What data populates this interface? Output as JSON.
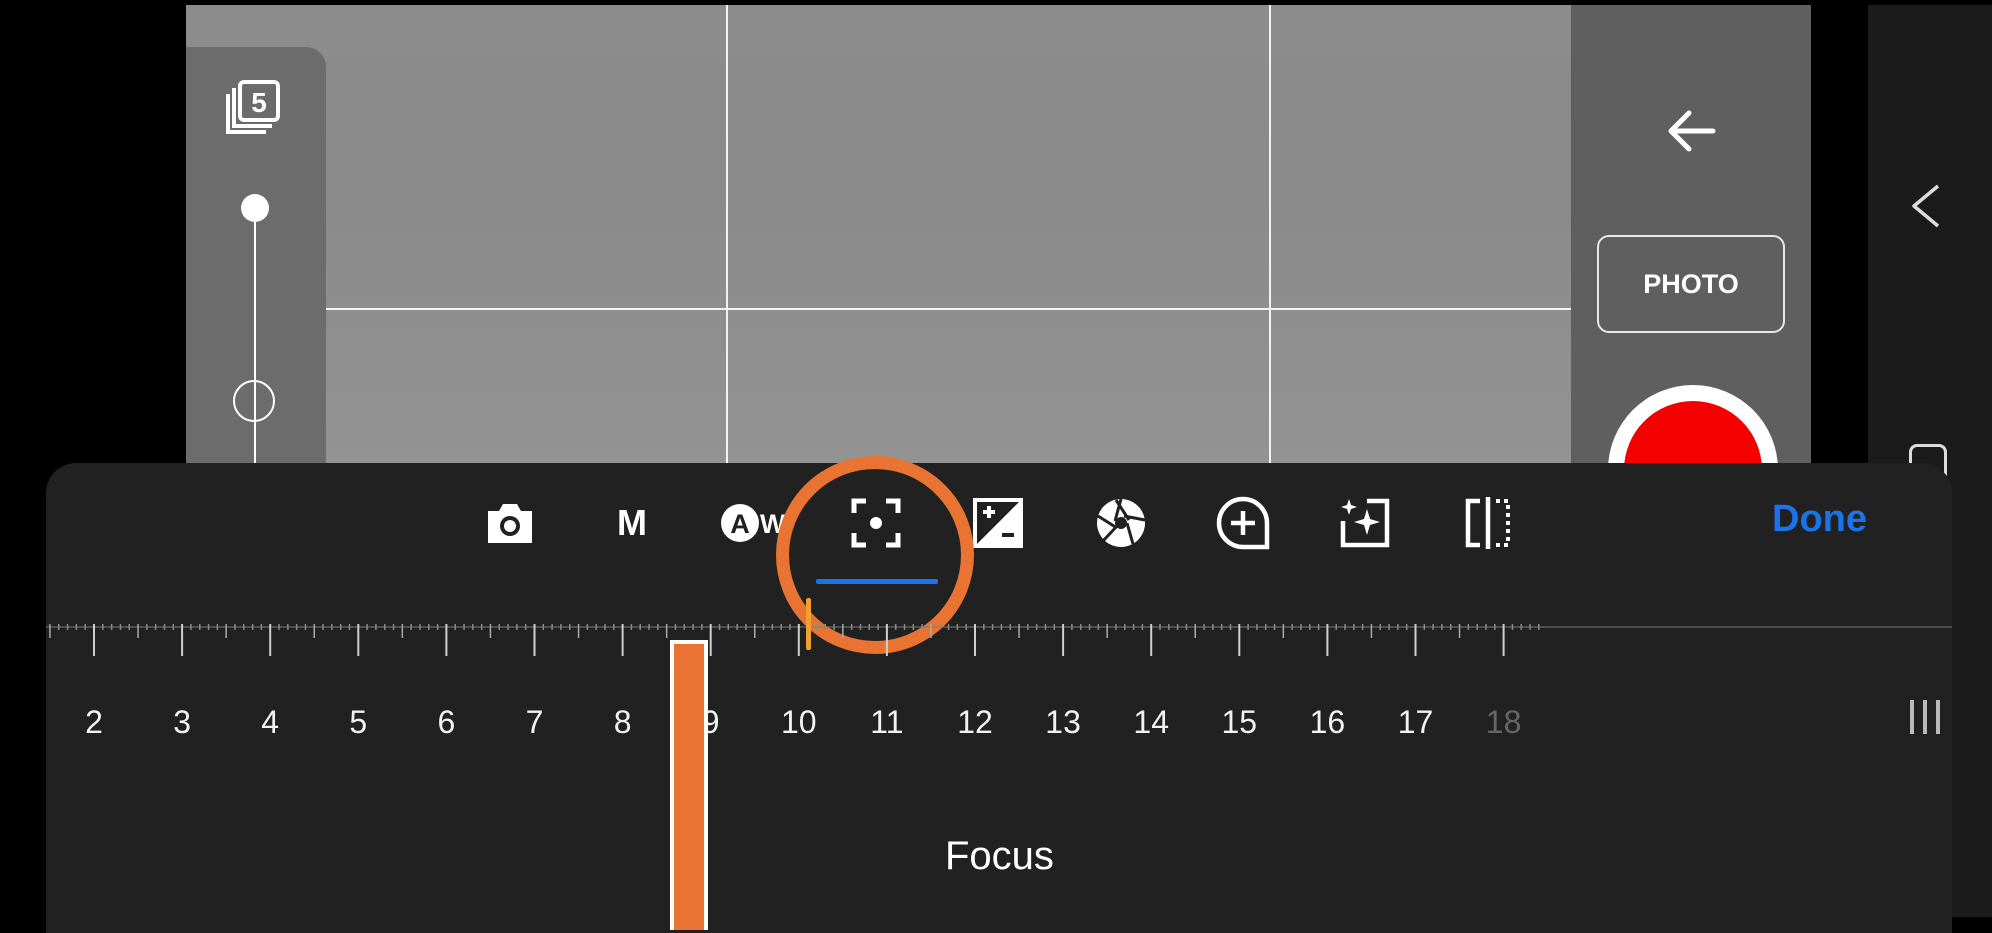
{
  "viewfinder": {
    "grid": "3x3",
    "colors": {
      "background": "#8c8c8c",
      "gridline": "#f2f2f2"
    }
  },
  "left_panel": {
    "burst_count": "5",
    "zoom_level": 0.0
  },
  "right_panel": {
    "mode_label": "PHOTO",
    "shutter_color": "#f40000"
  },
  "settings_sheet": {
    "tabs": [
      {
        "icon": "camera-icon",
        "label": ""
      },
      {
        "icon": "manual-mode-icon",
        "label": "M"
      },
      {
        "icon": "auto-white-balance-icon",
        "label": "AW"
      },
      {
        "icon": "focus-icon",
        "label": "",
        "selected": true
      },
      {
        "icon": "exposure-compensation-icon",
        "label": ""
      },
      {
        "icon": "aperture-icon",
        "label": ""
      },
      {
        "icon": "add-icon",
        "label": ""
      },
      {
        "icon": "enhance-icon",
        "label": ""
      },
      {
        "icon": "split-compare-icon",
        "label": ""
      }
    ],
    "done_label": "Done",
    "accent_color": "#1a73e8",
    "highlight_color": "#e87333",
    "scale": {
      "labels": [
        "2",
        "3",
        "4",
        "5",
        "6",
        "7",
        "8",
        "9",
        "10",
        "11",
        "12",
        "13",
        "14",
        "15",
        "16",
        "17",
        "18"
      ],
      "min": 2,
      "max": 18,
      "current_value": 10.1,
      "handle_value": 8.75
    },
    "setting_label": "Focus"
  },
  "nav_bar": {
    "icons": [
      "back-chevron-icon",
      "home-icon"
    ]
  }
}
